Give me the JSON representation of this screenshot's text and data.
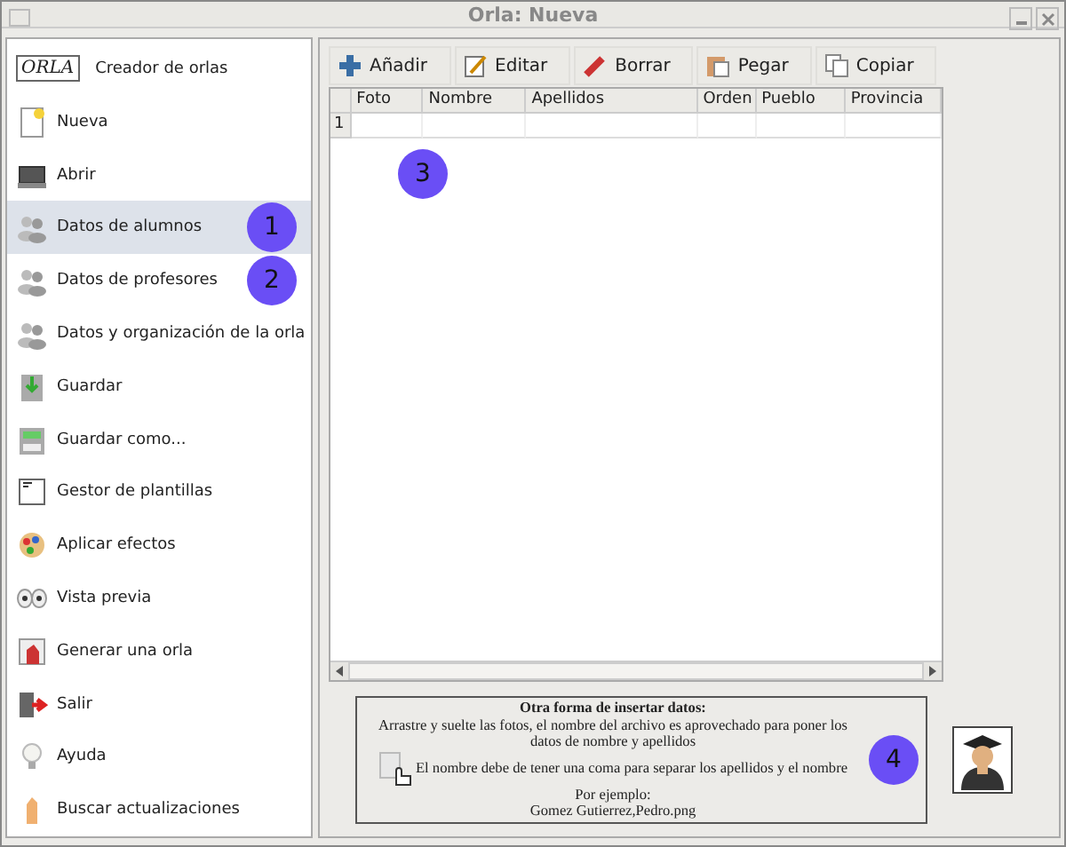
{
  "window": {
    "title": "Orla: Nueva"
  },
  "sidebar": {
    "items": [
      {
        "label": "Creador de orlas",
        "kind": "logo",
        "logo_text": "ORLA",
        "selected": false
      },
      {
        "label": "Nueva",
        "kind": "new",
        "selected": false
      },
      {
        "label": "Abrir",
        "kind": "open",
        "selected": false
      },
      {
        "label": "Datos de alumnos",
        "kind": "people",
        "selected": true,
        "marker": "1"
      },
      {
        "label": "Datos de profesores",
        "kind": "people",
        "selected": false,
        "marker": "2"
      },
      {
        "label": "Datos y organización de la orla",
        "kind": "people",
        "selected": false
      },
      {
        "label": "Guardar",
        "kind": "save",
        "selected": false
      },
      {
        "label": "Guardar como...",
        "kind": "saveas",
        "selected": false
      },
      {
        "label": "Gestor de plantillas",
        "kind": "template",
        "selected": false
      },
      {
        "label": "Aplicar efectos",
        "kind": "effects",
        "selected": false
      },
      {
        "label": "Vista previa",
        "kind": "preview",
        "selected": false
      },
      {
        "label": "Generar una orla",
        "kind": "generate",
        "selected": false
      },
      {
        "label": "Salir",
        "kind": "exit",
        "selected": false
      },
      {
        "label": "Ayuda",
        "kind": "help",
        "selected": false
      },
      {
        "label": "Buscar actualizaciones",
        "kind": "update",
        "selected": false
      }
    ]
  },
  "toolbar": [
    {
      "label": "Añadir",
      "kind": "add"
    },
    {
      "label": "Editar",
      "kind": "edit"
    },
    {
      "label": "Borrar",
      "kind": "delete"
    },
    {
      "label": "Pegar",
      "kind": "paste"
    },
    {
      "label": "Copiar",
      "kind": "copy"
    }
  ],
  "table": {
    "columns": [
      "Foto",
      "Nombre",
      "Apellidos",
      "Orden",
      "Pueblo",
      "Provincia"
    ],
    "rows": [
      {
        "number": "1"
      }
    ],
    "marker": "3"
  },
  "info": {
    "title": "Otra forma de insertar datos:",
    "lines": [
      "Arrastre y suelte las fotos, el nombre del archivo es aprovechado para poner los datos de nombre y apellidos",
      "El nombre debe de tener una coma para separar los apellidos y el nombre",
      "Por ejemplo:",
      "Gomez Gutierrez,Pedro.png"
    ],
    "marker": "4"
  }
}
